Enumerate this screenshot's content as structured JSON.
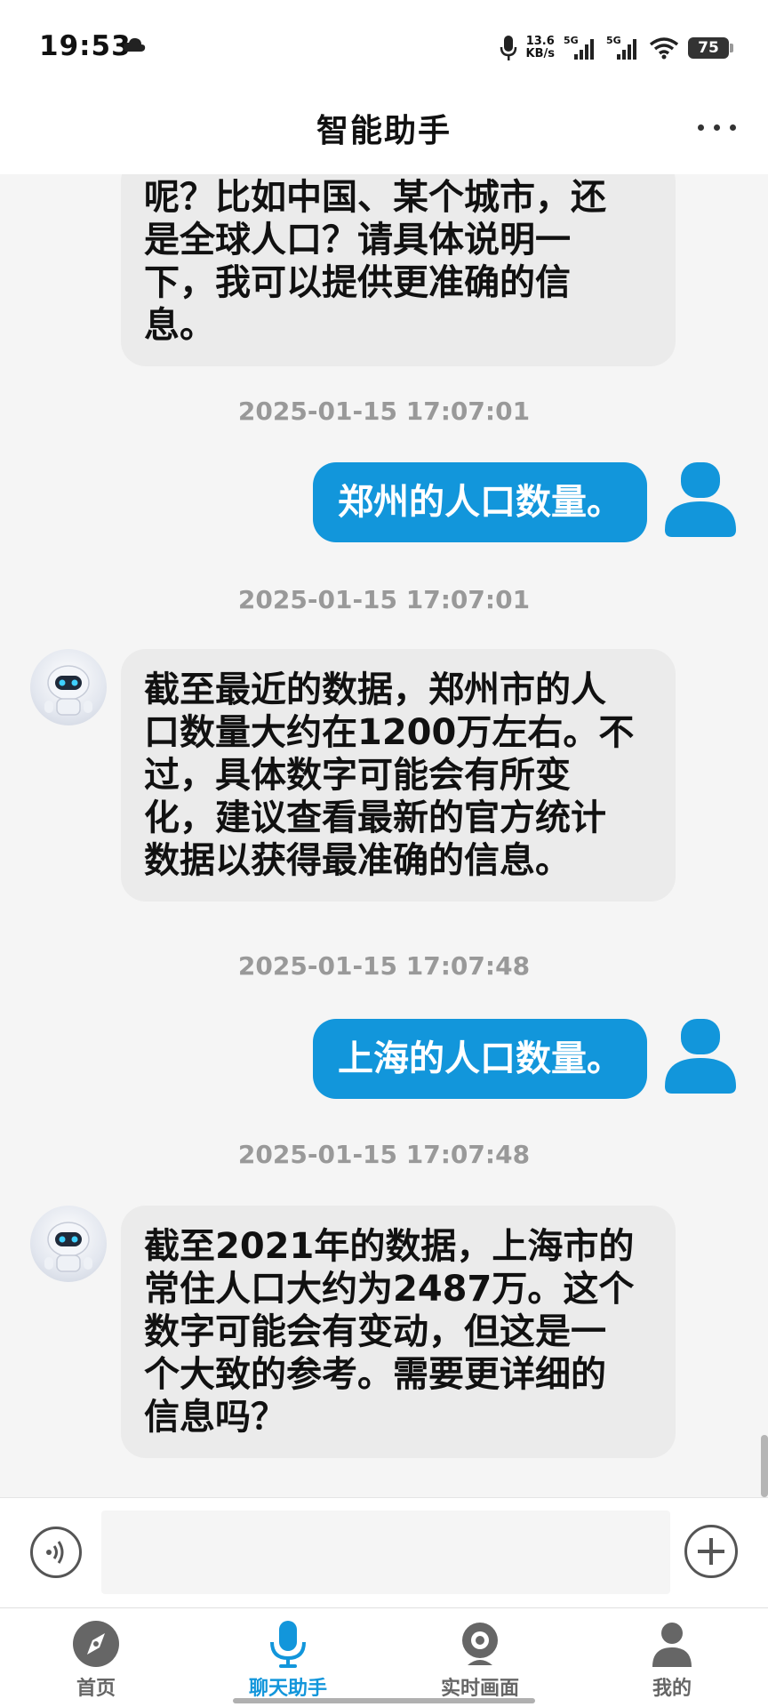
{
  "status_bar": {
    "time": "19:53",
    "net_speed_value": "13.6",
    "net_speed_unit": "KB/s",
    "signal1_tag": "5G",
    "signal2_tag": "5G",
    "battery": "75",
    "icons": [
      "cloud-icon",
      "microphone-icon",
      "signal-icon",
      "signal-icon",
      "wifi-icon",
      "battery-icon"
    ]
  },
  "header": {
    "title": "智能助手",
    "menu_icon": "more-icon"
  },
  "messages": [
    {
      "role": "bot",
      "lines": [
        "呢？比如中国、某个城市，还",
        "是全球人口？请具体说明一",
        "下，我可以提供更准确的信",
        "息。"
      ]
    },
    {
      "timestamp": "2025-01-15 17:07:01",
      "role": "user",
      "text": "郑州的人口数量。"
    },
    {
      "timestamp": "2025-01-15 17:07:01",
      "role": "bot",
      "lines": [
        "截至最近的数据，郑州市的人",
        "口数量大约在1200万左右。不",
        "过，具体数字可能会有所变",
        "化，建议查看最新的官方统计",
        "数据以获得最准确的信息。"
      ]
    },
    {
      "timestamp": "2025-01-15 17:07:48",
      "role": "user",
      "text": "上海的人口数量。"
    },
    {
      "timestamp": "2025-01-15 17:07:48",
      "role": "bot",
      "lines": [
        "截至2021年的数据，上海市的",
        "常住人口大约为2487万。这个",
        "数字可能会有变动，但这是一",
        "个大致的参考。需要更详细的",
        "信息吗？"
      ]
    }
  ],
  "input": {
    "value": "",
    "placeholder": ""
  },
  "bottom_nav": {
    "items": [
      {
        "label": "首页",
        "icon": "compass-icon",
        "active": false
      },
      {
        "label": "聊天助手",
        "icon": "microphone-icon",
        "active": true
      },
      {
        "label": "实时画面",
        "icon": "camera-icon",
        "active": false
      },
      {
        "label": "我的",
        "icon": "person-icon",
        "active": false
      }
    ]
  },
  "colors": {
    "accent": "#1296db",
    "bot_bubble": "#ebebeb",
    "background": "#f5f5f5",
    "timestamp": "#999999"
  }
}
